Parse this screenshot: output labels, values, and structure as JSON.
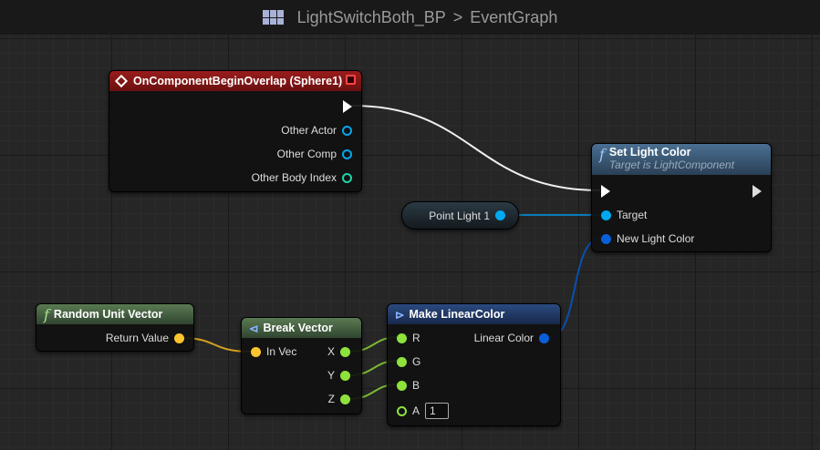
{
  "breadcrumb": {
    "blueprint": "LightSwitchBoth_BP",
    "separator": ">",
    "graph": "EventGraph"
  },
  "nodes": {
    "event": {
      "title": "OnComponentBeginOverlap (Sphere1)",
      "pins": [
        "Other Actor",
        "Other Comp",
        "Other Body Index"
      ]
    },
    "set_light_color": {
      "title": "Set Light Color",
      "subtitle": "Target is LightComponent",
      "pins": [
        "Target",
        "New Light Color"
      ]
    },
    "point_light": {
      "label": "Point Light 1"
    },
    "random_unit_vector": {
      "title": "Random Unit Vector",
      "pins": [
        "Return Value"
      ]
    },
    "break_vector": {
      "title": "Break Vector",
      "pins": [
        "In Vec",
        "X",
        "Y",
        "Z"
      ]
    },
    "make_linear_color": {
      "title": "Make LinearColor",
      "pins": [
        "R",
        "G",
        "B",
        "A",
        "Linear Color"
      ],
      "a_value": "1"
    }
  },
  "colors": {
    "exec": "#ffffff",
    "object": "#00a8f0",
    "struct_color": "#0a5fd8",
    "vector": "#fdc42f",
    "float": "#8ee23c",
    "int": "#1ed6a8",
    "event_header": "#8a1616",
    "function_header": "#3a5a78",
    "pure_header": "#45633f"
  }
}
